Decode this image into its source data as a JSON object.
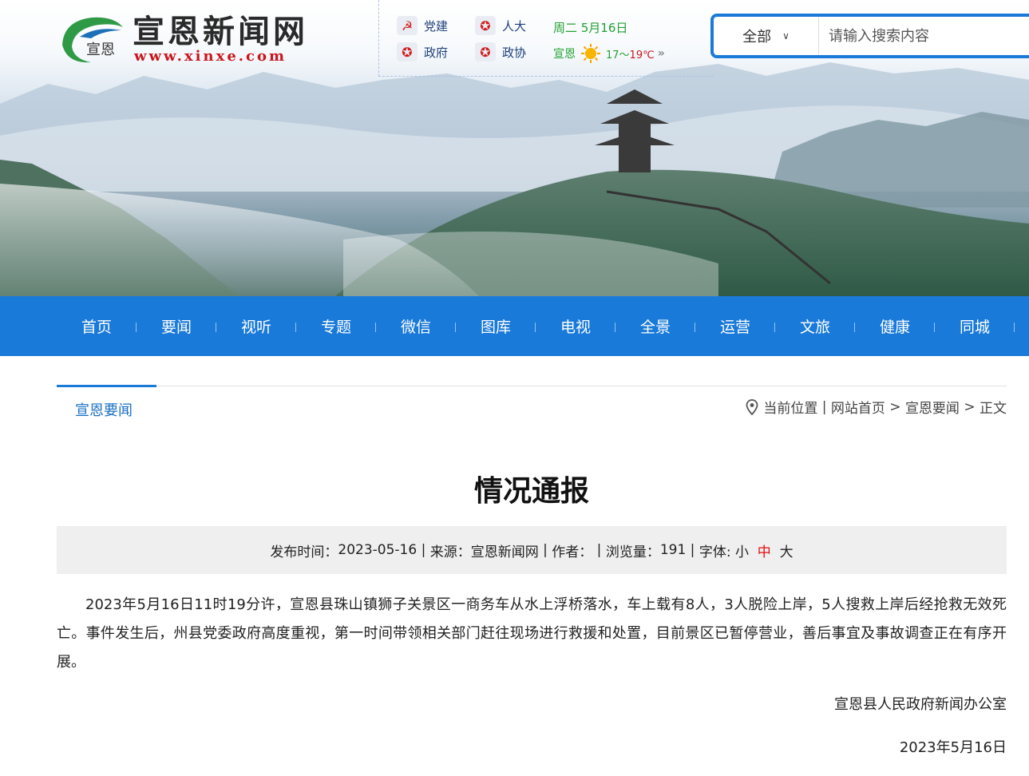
{
  "brand": {
    "logo_text": "宣恩新闻网",
    "logo_url": "www.xinxe.com",
    "logo_mark_text": "宣恩"
  },
  "quick_links": [
    {
      "label": "党建",
      "icon": "party-emblem-icon"
    },
    {
      "label": "人大",
      "icon": "national-emblem-icon"
    },
    {
      "label": "政府",
      "icon": "national-emblem-icon"
    },
    {
      "label": "政协",
      "icon": "cppcc-emblem-icon"
    }
  ],
  "header_info": {
    "date": "周二 5月16日",
    "city": "宣恩",
    "temp_low": "17～",
    "temp_high": "19℃",
    "weather_icon": "sunny-icon"
  },
  "search": {
    "scope": "全部",
    "placeholder": "请输入搜索内容"
  },
  "nav": {
    "items": [
      "首页",
      "要闻",
      "视听",
      "专题",
      "微信",
      "图库",
      "电视",
      "全景",
      "运营",
      "文旅",
      "健康",
      "同城"
    ]
  },
  "section": {
    "title": "宣恩要闻",
    "breadcrumb": {
      "prefix": "当前位置",
      "sep1": " | ",
      "home": "网站首页",
      "arrow1": " > ",
      "section": "宣恩要闻",
      "arrow2": " > ",
      "current": "正文"
    }
  },
  "article": {
    "title": "情况通报",
    "meta": {
      "publish_label": "发布时间：",
      "publish_date": "2023-05-16",
      "sep": " | ",
      "source_label": "来源：",
      "source": "宣恩新闻网",
      "author_label": "作者：",
      "views_label": "浏览量：",
      "views": "191",
      "font_label": "字体: ",
      "font_small": "小",
      "font_medium": "中",
      "font_large": "大"
    },
    "body": "2023年5月16日11时19分许，宣恩县珠山镇狮子关景区一商务车从水上浮桥落水，车上载有8人，3人脱险上岸，5人搜救上岸后经抢救无效死亡。事件发生后，州县党委政府高度重视，第一时间带领相关部门赶往现场进行救援和处置，目前景区已暂停营业，善后事宜及事故调查正在有序开展。",
    "signature": "宣恩县人民政府新闻办公室",
    "sign_date": "2023年5月16日"
  },
  "colors": {
    "primary": "#1a7ad9",
    "accent_red": "#c8161d",
    "weather_green": "#23a032"
  }
}
